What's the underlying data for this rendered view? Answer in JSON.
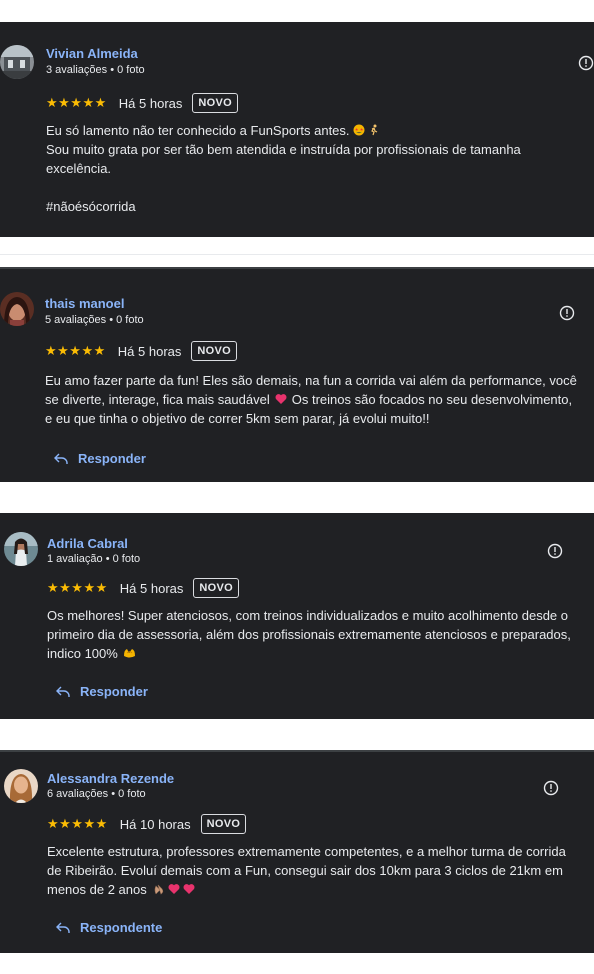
{
  "reviews": [
    {
      "author": "Vivian Almeida",
      "meta": "3 avaliações • 0 foto",
      "stars": "★★★★★",
      "time": "Há 5 horas",
      "badge": "NOVO",
      "lines": [
        "Eu só lamento não ter conhecido a FunSports antes.",
        "Sou muito grata por ser tão bem atendida e instruída por profissionais de tamanha",
        "excelência.",
        "",
        "#nãoésócorrida"
      ]
    },
    {
      "author": "thais manoel",
      "meta": "5 avaliações • 0 foto",
      "stars": "★★★★★",
      "time": "Há 5 horas",
      "badge": "NOVO",
      "lines": [
        "Eu amo fazer parte da fun! Eles são demais, na fun a corrida vai além da performance, você",
        "se diverte, interage, fica mais saudável",
        "Os treinos são focados no seu desenvolvimento,",
        "e eu que tinha o objetivo de correr 5km sem parar, já evolui muito!!"
      ],
      "reply": "Responder"
    },
    {
      "author": "Adrila Cabral",
      "meta": "1 avaliação • 0 foto",
      "stars": "★★★★★",
      "time": "Há 5 horas",
      "badge": "NOVO",
      "lines": [
        "Os melhores! Super atenciosos, com treinos individualizados e muito acolhimento desde o",
        "primeiro dia de assessoria, além dos profissionais extremamente atenciosos e preparados,",
        "indico 100%"
      ],
      "reply": "Responder"
    },
    {
      "author": "Alessandra Rezende",
      "meta": "6 avaliações • 0 foto",
      "stars": "★★★★★",
      "time": "Há 10 horas",
      "badge": "NOVO",
      "lines": [
        "Excelente estrutura, professores extremamente competentes, e a melhor turma de corrida",
        "de Ribeirão. Evoluí demais com a Fun, consegui sair dos 10km para 3 ciclos de 21km em",
        "menos de 2 anos"
      ],
      "reply": "Respondente"
    }
  ],
  "colors": {
    "card_bg": "#202124",
    "name": "#8ab4f8",
    "stars": "#fbbc04",
    "text": "#e8eaed",
    "heart": "#e8336d"
  },
  "icons": [
    "info-icon",
    "reply-arrow-icon",
    "star-struck-emoji-icon",
    "runner-emoji-icon",
    "heart-emoji-icon",
    "hands-emoji-icon",
    "clap-emoji-icon"
  ]
}
